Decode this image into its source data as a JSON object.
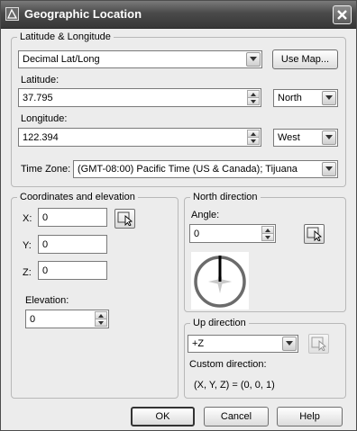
{
  "window": {
    "title": "Geographic Location"
  },
  "latlong": {
    "group_label": "Latitude & Longitude",
    "format_value": "Decimal Lat/Long",
    "use_map_label": "Use Map...",
    "latitude_label": "Latitude:",
    "latitude_value": "37.795",
    "latitude_dir": "North",
    "longitude_label": "Longitude:",
    "longitude_value": "122.394",
    "longitude_dir": "West",
    "timezone_label": "Time Zone:",
    "timezone_value": "(GMT-08:00) Pacific Time (US & Canada); Tijuana"
  },
  "coords": {
    "group_label": "Coordinates and elevation",
    "x_label": "X:",
    "x_value": "0",
    "y_label": "Y:",
    "y_value": "0",
    "z_label": "Z:",
    "z_value": "0",
    "elevation_label": "Elevation:",
    "elevation_value": "0"
  },
  "north": {
    "group_label": "North direction",
    "angle_label": "Angle:",
    "angle_value": "0"
  },
  "up": {
    "group_label": "Up direction",
    "direction_value": "+Z",
    "custom_label": "Custom direction:",
    "custom_value": "(X, Y, Z) = (0, 0, 1)"
  },
  "buttons": {
    "ok": "OK",
    "cancel": "Cancel",
    "help": "Help"
  },
  "icons": {
    "app": "app-icon",
    "close": "close-icon",
    "dropdown": "chevron-down-icon",
    "spin_up": "spin-up-icon",
    "spin_down": "spin-down-icon",
    "pick": "pick-point-icon",
    "compass": "compass-icon"
  }
}
